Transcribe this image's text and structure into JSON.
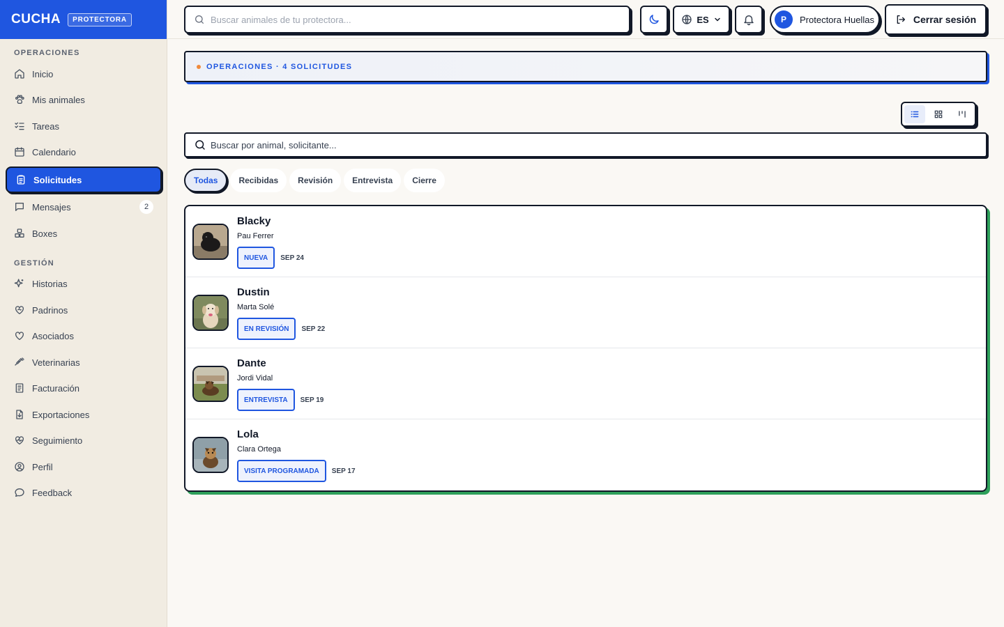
{
  "brand": {
    "name": "CUCHA",
    "badge": "PROTECTORA"
  },
  "sidebar": {
    "section_ops": "OPERACIONES",
    "section_mgmt": "GESTIÓN",
    "ops_items": [
      {
        "label": "Inicio",
        "icon": "home-icon"
      },
      {
        "label": "Mis animales",
        "icon": "paw-icon"
      },
      {
        "label": "Tareas",
        "icon": "checklist-icon"
      },
      {
        "label": "Calendario",
        "icon": "calendar-icon"
      },
      {
        "label": "Solicitudes",
        "icon": "clipboard-icon",
        "active": true
      },
      {
        "label": "Mensajes",
        "icon": "message-icon",
        "badge": "2"
      },
      {
        "label": "Boxes",
        "icon": "boxes-icon"
      }
    ],
    "mgmt_items": [
      {
        "label": "Historias",
        "icon": "sparkle-icon"
      },
      {
        "label": "Padrinos",
        "icon": "heart-handshake-icon"
      },
      {
        "label": "Asociados",
        "icon": "heart-icon"
      },
      {
        "label": "Veterinarias",
        "icon": "syringe-icon"
      },
      {
        "label": "Facturación",
        "icon": "receipt-icon"
      },
      {
        "label": "Exportaciones",
        "icon": "file-download-icon"
      },
      {
        "label": "Seguimiento",
        "icon": "heart-pulse-icon"
      },
      {
        "label": "Perfil",
        "icon": "user-circle-icon"
      },
      {
        "label": "Feedback",
        "icon": "chat-bubble-icon"
      }
    ]
  },
  "header": {
    "search_placeholder": "Buscar animales de tu protectora...",
    "language": "ES",
    "account_initial": "P",
    "account_name": "Protectora Huellas",
    "logout_label": "Cerrar sesión"
  },
  "banner": {
    "text": "OPERACIONES · 4 SOLICITUDES"
  },
  "list_search": {
    "placeholder": "Buscar por animal, solicitante..."
  },
  "filters": [
    "Todas",
    "Recibidas",
    "Revisión",
    "Entrevista",
    "Cierre"
  ],
  "requests": [
    {
      "animal": "Blacky",
      "applicant": "Pau Ferrer",
      "status": "NUEVA",
      "date": "SEP 24"
    },
    {
      "animal": "Dustin",
      "applicant": "Marta Solé",
      "status": "EN REVISIÓN",
      "date": "SEP 22"
    },
    {
      "animal": "Dante",
      "applicant": "Jordi Vidal",
      "status": "ENTREVISTA",
      "date": "SEP 19"
    },
    {
      "animal": "Lola",
      "applicant": "Clara Ortega",
      "status": "VISITA PROGRAMADA",
      "date": "SEP 17"
    }
  ],
  "colors": {
    "accent": "#1f56e0",
    "success_shadow": "#2ea05a",
    "sidebar_bg": "#f1ece2"
  }
}
